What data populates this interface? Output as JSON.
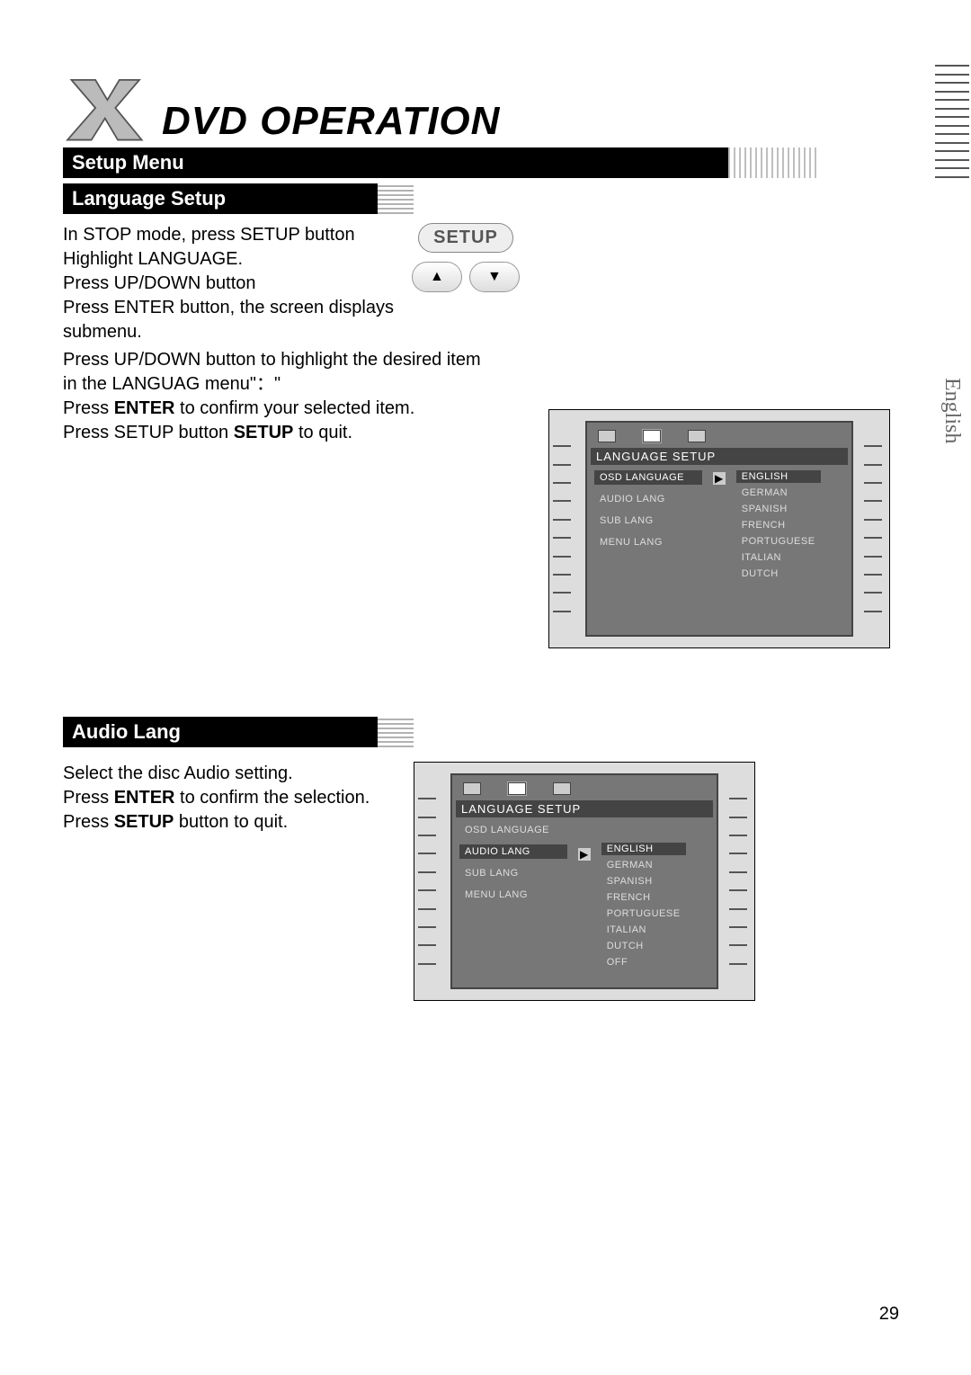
{
  "page": {
    "title": "DVD OPERATION",
    "setup_bar": "Setup Menu",
    "tab_label": "English",
    "page_number": "29"
  },
  "section1": {
    "heading": "Language Setup",
    "buttons": {
      "setup_label": "SETUP"
    },
    "instr_lines": [
      "In STOP mode, press SETUP button",
      "Highlight LANGUAGE.",
      "Press UP/DOWN button",
      "Press ENTER button, the screen displays",
      "submenu."
    ],
    "instr_wide1": "Press UP/DOWN button to highlight the desired item",
    "instr_wide2": "in the LANGUAG menu\"：\"",
    "instr_confirm_pre": "Press ",
    "instr_confirm_bold": "ENTER",
    "instr_confirm_post": " to confirm your selected item.",
    "instr_quit_pre": "Press SETUP button ",
    "instr_quit_bold": "SETUP",
    "instr_quit_post": " to quit."
  },
  "osd1": {
    "title": "LANGUAGE SETUP",
    "left_items": [
      "OSD LANGUAGE",
      "AUDIO LANG",
      "SUB LANG",
      "MENU LANG"
    ],
    "left_selected_index": 0,
    "right_items": [
      "ENGLISH",
      "GERMAN",
      "SPANISH",
      "FRENCH",
      "PORTUGUESE",
      "ITALIAN",
      "DUTCH"
    ],
    "right_selected_index": 0
  },
  "section2": {
    "heading": "Audio Lang",
    "line1": "Select the disc Audio setting.",
    "line2_pre": "Press  ",
    "line2_bold": "ENTER",
    "line2_post": " to confirm the selection.",
    "line3_pre": "Press ",
    "line3_bold": "SETUP",
    "line3_post": " button to quit."
  },
  "osd2": {
    "title": "LANGUAGE SETUP",
    "left_items": [
      "OSD LANGUAGE",
      "AUDIO LANG",
      "SUB LANG",
      "MENU LANG"
    ],
    "left_selected_index": 1,
    "right_items": [
      "ENGLISH",
      "GERMAN",
      "SPANISH",
      "FRENCH",
      "PORTUGUESE",
      "ITALIAN",
      "DUTCH",
      "OFF"
    ],
    "right_selected_index": 0
  }
}
